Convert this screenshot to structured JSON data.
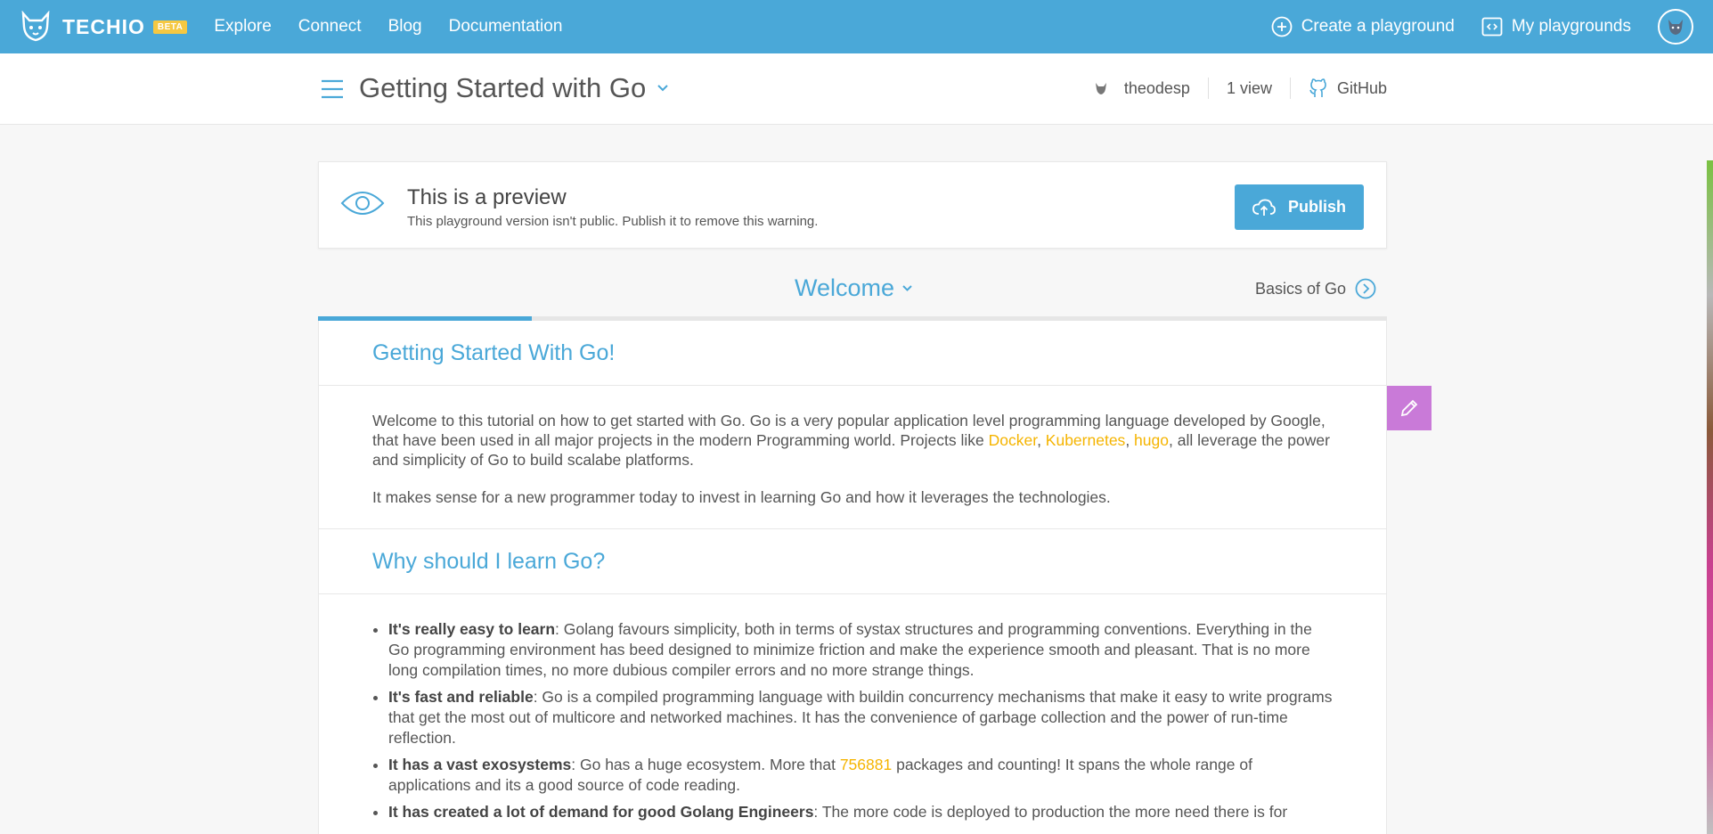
{
  "brand": {
    "name": "TECHIO",
    "badge": "BETA"
  },
  "nav": {
    "links": [
      "Explore",
      "Connect",
      "Blog",
      "Documentation"
    ]
  },
  "top_actions": {
    "create": "Create a playground",
    "mine": "My playgrounds"
  },
  "header": {
    "title": "Getting Started with Go",
    "author": "theodesp",
    "views": "1 view",
    "github": "GitHub"
  },
  "preview": {
    "title": "This is a preview",
    "subtitle": "This playground version isn't public. Publish it to remove this warning.",
    "publish_label": "Publish"
  },
  "lesson": {
    "current": "Welcome",
    "next": "Basics of Go",
    "progress": 0.2
  },
  "section1": {
    "title": "Getting Started With Go!",
    "p1_a": "Welcome to this tutorial on how to get started with Go. Go is a very popular application level programming language developed by Google, that have been used in all major projects in the modern Programming world. Projects like ",
    "link_docker": "Docker",
    "comma1": ", ",
    "link_k8s": "Kubernetes",
    "comma2": ", ",
    "link_hugo": "hugo",
    "p1_b": ", all leverage the power and simplicity of Go to build scalabe platforms.",
    "p2": "It makes sense for a new programmer today to invest in learning Go and how it leverages the technologies."
  },
  "section2": {
    "title": "Why should I learn Go?",
    "items": [
      {
        "bold": "It's really easy to learn",
        "text": ": Golang favours simplicity, both in terms of systax structures and programming conventions. Everything in the Go programming environment has beed designed to minimize friction and make the experience smooth and pleasant. That is no more long compilation times, no more dubious compiler errors and no more strange things."
      },
      {
        "bold": "It's fast and reliable",
        "text": ": Go is a compiled programming language with buildin concurrency mechanisms that make it easy to write programs that get the most out of multicore and networked machines. It has the convenience of garbage collection and the power of run-time reflection."
      },
      {
        "bold": "It has a vast exosystems",
        "text_a": ": Go has a huge ecosystem. More that ",
        "link": "756881",
        "text_b": " packages and counting! It spans the whole range of applications and its a good source of code reading."
      },
      {
        "bold": "It has created a lot of demand for good Golang Engineers",
        "text": ": The more code is deployed to production the more need there is for"
      }
    ]
  },
  "colors": {
    "primary": "#4aa8d8",
    "link": "#f5b400",
    "edit": "#c97ad8"
  }
}
